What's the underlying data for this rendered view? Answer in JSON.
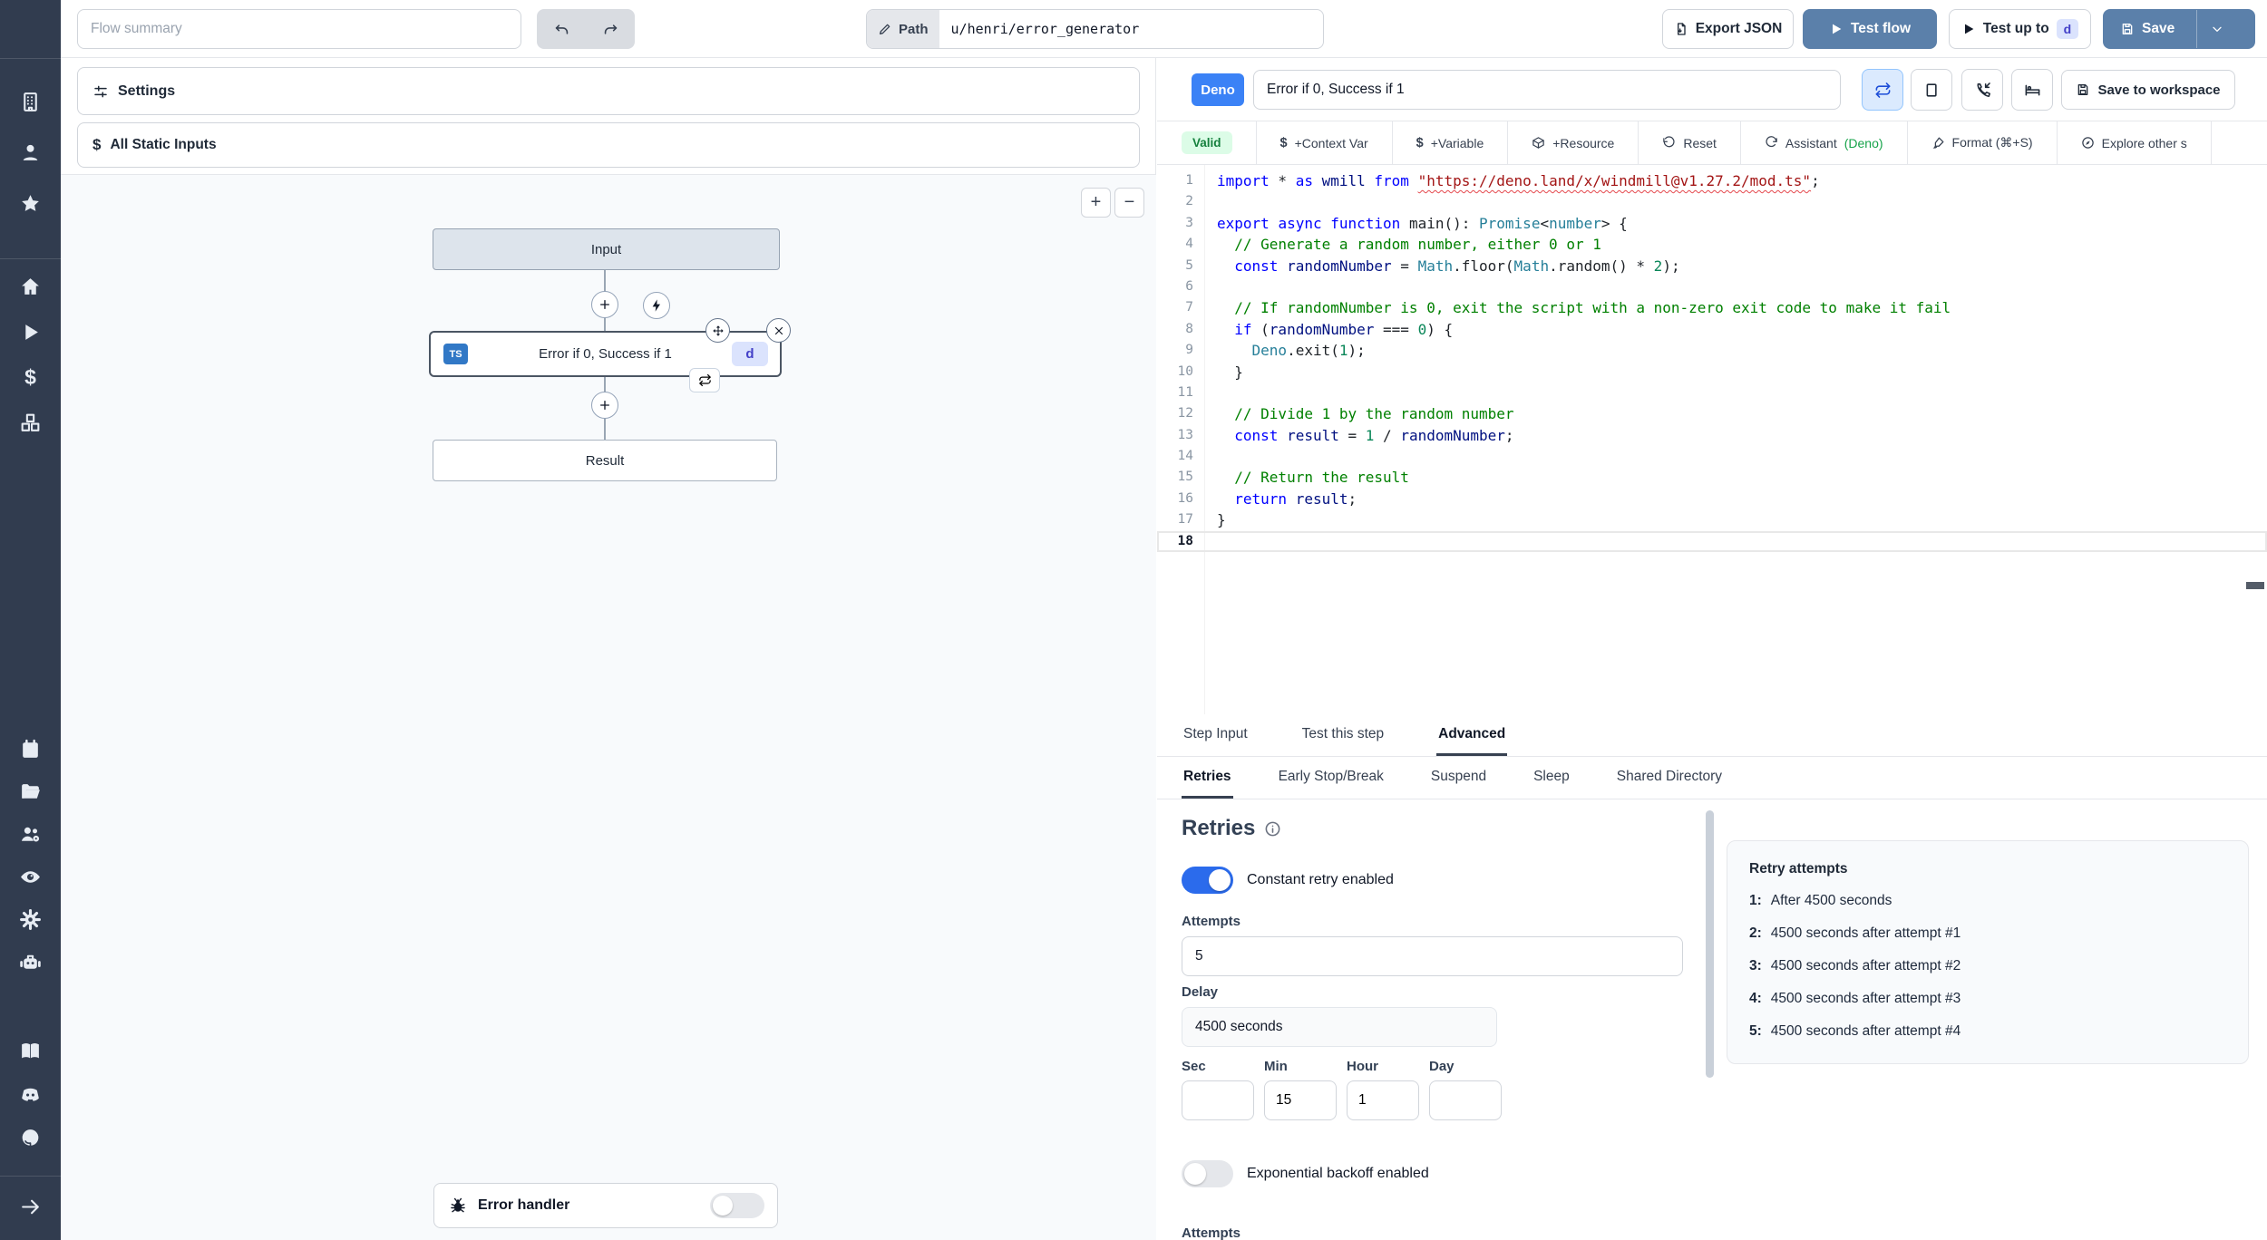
{
  "colors": {
    "sidebar_bg": "#313c4f",
    "steel_blue": "#5b80aa",
    "deno_blue": "#3b82f6",
    "toggle_on_blue": "#2b6bec",
    "valid_bg": "#dcfce7",
    "valid_text": "#15803d",
    "ts_badge_blue": "#3178c6",
    "d_badge_bg": "#dbe3fd",
    "d_badge_text": "#4340c8",
    "canvas_bg": "#f8fafc",
    "code_keyword": "#0000ff",
    "code_type": "#267f99",
    "code_comment": "#008000",
    "code_number": "#098658",
    "code_string": "#a31515",
    "code_default": "#1f2328"
  },
  "sidebar": {
    "logo_icon": "windmill-logo",
    "groups": [
      [
        "building",
        "user",
        "star"
      ],
      [
        "home",
        "play",
        "dollar",
        "boxes"
      ],
      [
        "calendar",
        "folder",
        "users-gear",
        "eye",
        "gear",
        "robot"
      ],
      [
        "book",
        "discord",
        "github"
      ],
      [
        "arrow-right"
      ]
    ]
  },
  "topbar": {
    "flow_summary_placeholder": "Flow summary",
    "path_label": "Path",
    "path_value": "u/henri/error_generator",
    "export_json": "Export JSON",
    "test_flow": "Test flow",
    "test_up_to": "Test up to",
    "test_badge": "d",
    "save": "Save"
  },
  "flow": {
    "settings_label": "Settings",
    "static_inputs_label": "All Static Inputs",
    "zoom_in": "+",
    "zoom_out": "−",
    "nodes": {
      "input_label": "Input",
      "step_label": "Error if 0, Success if 1",
      "step_lang": "TS",
      "step_badge": "d",
      "result_label": "Result"
    },
    "error_handler_label": "Error handler"
  },
  "editor": {
    "lang_badge": "Deno",
    "title": "Error if 0, Success if 1",
    "save_to_workspace": "Save to workspace",
    "header_buttons": [
      {
        "icon": "repeat",
        "active": true
      },
      {
        "icon": "square",
        "active": false
      },
      {
        "icon": "phone-incoming",
        "active": false
      },
      {
        "icon": "bed",
        "active": false
      }
    ],
    "toolbar": {
      "items": [
        {
          "badge": true,
          "label": "Valid"
        },
        {
          "icon": "dollar",
          "label": "+Context Var"
        },
        {
          "icon": "dollar",
          "label": "+Variable"
        },
        {
          "icon": "box",
          "label": "+Resource"
        },
        {
          "icon": "rotate-ccw",
          "label": "Reset"
        },
        {
          "icon": "refresh-cw",
          "label": "Assistant",
          "suffix": "(Deno)"
        },
        {
          "icon": "brush",
          "label": "Format (⌘+S)"
        },
        {
          "icon": "compass",
          "label": "Explore other s"
        }
      ]
    },
    "code": {
      "lines": [
        {
          "n": 1,
          "tokens": [
            {
              "t": "import",
              "c": "k"
            },
            {
              "t": " * ",
              "c": "d"
            },
            {
              "t": "as",
              "c": "k"
            },
            {
              "t": " wmill ",
              "c": "v"
            },
            {
              "t": "from",
              "c": "k"
            },
            {
              "t": " ",
              "c": "d"
            },
            {
              "t": "\"https://deno.land/x/windmill@v1.27.2/mod.ts\"",
              "c": "u"
            },
            {
              "t": ";",
              "c": "d"
            }
          ]
        },
        {
          "n": 2,
          "tokens": []
        },
        {
          "n": 3,
          "tokens": [
            {
              "t": "export",
              "c": "k"
            },
            {
              "t": " ",
              "c": "d"
            },
            {
              "t": "async",
              "c": "k"
            },
            {
              "t": " ",
              "c": "d"
            },
            {
              "t": "function",
              "c": "k"
            },
            {
              "t": " main(): ",
              "c": "d"
            },
            {
              "t": "Promise",
              "c": "t"
            },
            {
              "t": "<",
              "c": "d"
            },
            {
              "t": "number",
              "c": "t"
            },
            {
              "t": "> {",
              "c": "d"
            }
          ]
        },
        {
          "n": 4,
          "tokens": [
            {
              "t": "  // Generate a random number, either 0 or 1",
              "c": "c"
            }
          ]
        },
        {
          "n": 5,
          "tokens": [
            {
              "t": "  ",
              "c": "d"
            },
            {
              "t": "const",
              "c": "k"
            },
            {
              "t": " ",
              "c": "d"
            },
            {
              "t": "randomNumber",
              "c": "v"
            },
            {
              "t": " = ",
              "c": "d"
            },
            {
              "t": "Math",
              "c": "t"
            },
            {
              "t": ".floor(",
              "c": "d"
            },
            {
              "t": "Math",
              "c": "t"
            },
            {
              "t": ".random() * ",
              "c": "d"
            },
            {
              "t": "2",
              "c": "n"
            },
            {
              "t": ");",
              "c": "d"
            }
          ]
        },
        {
          "n": 6,
          "tokens": []
        },
        {
          "n": 7,
          "tokens": [
            {
              "t": "  // If randomNumber is 0, exit the script with a non-zero exit code to make it fail",
              "c": "c"
            }
          ]
        },
        {
          "n": 8,
          "tokens": [
            {
              "t": "  ",
              "c": "d"
            },
            {
              "t": "if",
              "c": "k"
            },
            {
              "t": " (",
              "c": "d"
            },
            {
              "t": "randomNumber",
              "c": "v"
            },
            {
              "t": " === ",
              "c": "d"
            },
            {
              "t": "0",
              "c": "n"
            },
            {
              "t": ") {",
              "c": "d"
            }
          ]
        },
        {
          "n": 9,
          "tokens": [
            {
              "t": "    ",
              "c": "d"
            },
            {
              "t": "Deno",
              "c": "t"
            },
            {
              "t": ".exit(",
              "c": "d"
            },
            {
              "t": "1",
              "c": "n"
            },
            {
              "t": ");",
              "c": "d"
            }
          ]
        },
        {
          "n": 10,
          "tokens": [
            {
              "t": "  }",
              "c": "d"
            }
          ]
        },
        {
          "n": 11,
          "tokens": []
        },
        {
          "n": 12,
          "tokens": [
            {
              "t": "  // Divide 1 by the random number",
              "c": "c"
            }
          ]
        },
        {
          "n": 13,
          "tokens": [
            {
              "t": "  ",
              "c": "d"
            },
            {
              "t": "const",
              "c": "k"
            },
            {
              "t": " ",
              "c": "d"
            },
            {
              "t": "result",
              "c": "v"
            },
            {
              "t": " = ",
              "c": "d"
            },
            {
              "t": "1",
              "c": "n"
            },
            {
              "t": " / ",
              "c": "d"
            },
            {
              "t": "randomNumber",
              "c": "v"
            },
            {
              "t": ";",
              "c": "d"
            }
          ]
        },
        {
          "n": 14,
          "tokens": []
        },
        {
          "n": 15,
          "tokens": [
            {
              "t": "  // Return the result",
              "c": "c"
            }
          ]
        },
        {
          "n": 16,
          "tokens": [
            {
              "t": "  ",
              "c": "d"
            },
            {
              "t": "return",
              "c": "k"
            },
            {
              "t": " ",
              "c": "d"
            },
            {
              "t": "result",
              "c": "v"
            },
            {
              "t": ";",
              "c": "d"
            }
          ]
        },
        {
          "n": 17,
          "tokens": [
            {
              "t": "}",
              "c": "d"
            }
          ]
        },
        {
          "n": 18,
          "tokens": [],
          "active": true
        }
      ]
    }
  },
  "bottom": {
    "tabs": [
      {
        "label": "Step Input",
        "active": false
      },
      {
        "label": "Test this step",
        "active": false
      },
      {
        "label": "Advanced",
        "active": true
      }
    ],
    "subtabs": [
      {
        "label": "Retries",
        "active": true
      },
      {
        "label": "Early Stop/Break",
        "active": false
      },
      {
        "label": "Suspend",
        "active": false
      },
      {
        "label": "Sleep",
        "active": false
      },
      {
        "label": "Shared Directory",
        "active": false
      }
    ],
    "retries": {
      "heading": "Retries",
      "constant_label": "Constant retry enabled",
      "constant_enabled": true,
      "attempts_label": "Attempts",
      "attempts_value": "5",
      "delay_label": "Delay",
      "delay_value": "4500 seconds",
      "time_fields": [
        {
          "label": "Sec",
          "value": ""
        },
        {
          "label": "Min",
          "value": "15"
        },
        {
          "label": "Hour",
          "value": "1"
        },
        {
          "label": "Day",
          "value": ""
        }
      ],
      "exponential_label": "Exponential backoff enabled",
      "exponential_enabled": false,
      "cropped_label": "Attempts",
      "attempts_panel": {
        "title": "Retry attempts",
        "items": [
          {
            "n": "1:",
            "text": "After 4500 seconds"
          },
          {
            "n": "2:",
            "text": "4500 seconds after attempt #1"
          },
          {
            "n": "3:",
            "text": "4500 seconds after attempt #2"
          },
          {
            "n": "4:",
            "text": "4500 seconds after attempt #3"
          },
          {
            "n": "5:",
            "text": "4500 seconds after attempt #4"
          }
        ]
      }
    }
  }
}
